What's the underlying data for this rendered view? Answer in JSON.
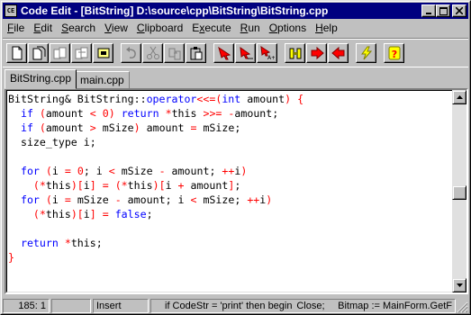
{
  "window": {
    "app_icon_text": "CE",
    "title": "Code Edit - [BitString] D:\\source\\cpp\\BitString\\BitString.cpp",
    "min_glyph": "_",
    "max_glyph": "□",
    "close_glyph": "×"
  },
  "menu": [
    {
      "pre": "",
      "u": "F",
      "post": "ile"
    },
    {
      "pre": "",
      "u": "E",
      "post": "dit"
    },
    {
      "pre": "",
      "u": "S",
      "post": "earch"
    },
    {
      "pre": "",
      "u": "V",
      "post": "iew"
    },
    {
      "pre": "",
      "u": "C",
      "post": "lipboard"
    },
    {
      "pre": "E",
      "u": "x",
      "post": "ecute"
    },
    {
      "pre": "",
      "u": "R",
      "post": "un"
    },
    {
      "pre": "",
      "u": "O",
      "post": "ptions"
    },
    {
      "pre": "",
      "u": "H",
      "post": "elp"
    }
  ],
  "toolbar": {
    "groups": [
      [
        "new-file-icon",
        "open-file-icon",
        "copy-file-icon",
        "save-file-icon",
        "save-all-icon"
      ],
      [
        "undo-icon",
        "cut-icon",
        "copy-icon",
        "paste-icon"
      ],
      [
        "find-icon",
        "find-next-icon",
        "replace-icon"
      ],
      [
        "compile-icon",
        "run-icon",
        "stop-icon"
      ],
      [
        "lightning-icon"
      ],
      [
        "help-icon"
      ]
    ]
  },
  "tabs": [
    {
      "label": "BitString.cpp",
      "active": true
    },
    {
      "label": "main.cpp",
      "active": false
    }
  ],
  "code_lines": [
    [
      [
        "t",
        "BitString& BitString::"
      ],
      [
        "kw",
        "operator"
      ],
      [
        "op",
        "<<=("
      ],
      [
        "kw",
        "int"
      ],
      [
        "t",
        " amount"
      ],
      [
        "op",
        ")"
      ],
      [
        "t",
        " "
      ],
      [
        "op",
        "{"
      ]
    ],
    [
      [
        "t",
        "  "
      ],
      [
        "kw",
        "if"
      ],
      [
        "t",
        " "
      ],
      [
        "op",
        "("
      ],
      [
        "t",
        "amount "
      ],
      [
        "op",
        "<"
      ],
      [
        "t",
        " "
      ],
      [
        "num",
        "0"
      ],
      [
        "op",
        ")"
      ],
      [
        "t",
        " "
      ],
      [
        "kw",
        "return"
      ],
      [
        "t",
        " "
      ],
      [
        "op",
        "*"
      ],
      [
        "t",
        "this "
      ],
      [
        "op",
        ">>="
      ],
      [
        "t",
        " "
      ],
      [
        "op",
        "-"
      ],
      [
        "t",
        "amount;"
      ]
    ],
    [
      [
        "t",
        "  "
      ],
      [
        "kw",
        "if"
      ],
      [
        "t",
        " "
      ],
      [
        "op",
        "("
      ],
      [
        "t",
        "amount "
      ],
      [
        "op",
        ">"
      ],
      [
        "t",
        " mSize"
      ],
      [
        "op",
        ")"
      ],
      [
        "t",
        " amount "
      ],
      [
        "op",
        "="
      ],
      [
        "t",
        " mSize;"
      ]
    ],
    [
      [
        "t",
        "  size_type i;"
      ]
    ],
    [
      [
        "t",
        ""
      ]
    ],
    [
      [
        "t",
        "  "
      ],
      [
        "kw",
        "for"
      ],
      [
        "t",
        " "
      ],
      [
        "op",
        "("
      ],
      [
        "t",
        "i "
      ],
      [
        "op",
        "="
      ],
      [
        "t",
        " "
      ],
      [
        "num",
        "0"
      ],
      [
        "t",
        "; i "
      ],
      [
        "op",
        "<"
      ],
      [
        "t",
        " mSize "
      ],
      [
        "op",
        "-"
      ],
      [
        "t",
        " amount; "
      ],
      [
        "op",
        "++"
      ],
      [
        "t",
        "i"
      ],
      [
        "op",
        ")"
      ]
    ],
    [
      [
        "t",
        "    "
      ],
      [
        "op",
        "(*"
      ],
      [
        "t",
        "this"
      ],
      [
        "op",
        ")["
      ],
      [
        "t",
        "i"
      ],
      [
        "op",
        "]"
      ],
      [
        "t",
        " "
      ],
      [
        "op",
        "="
      ],
      [
        "t",
        " "
      ],
      [
        "op",
        "(*"
      ],
      [
        "t",
        "this"
      ],
      [
        "op",
        ")["
      ],
      [
        "t",
        "i "
      ],
      [
        "op",
        "+"
      ],
      [
        "t",
        " amount"
      ],
      [
        "op",
        "]"
      ],
      [
        "t",
        ";"
      ]
    ],
    [
      [
        "t",
        "  "
      ],
      [
        "kw",
        "for"
      ],
      [
        "t",
        " "
      ],
      [
        "op",
        "("
      ],
      [
        "t",
        "i "
      ],
      [
        "op",
        "="
      ],
      [
        "t",
        " mSize "
      ],
      [
        "op",
        "-"
      ],
      [
        "t",
        " amount; i "
      ],
      [
        "op",
        "<"
      ],
      [
        "t",
        " mSize; "
      ],
      [
        "op",
        "++"
      ],
      [
        "t",
        "i"
      ],
      [
        "op",
        ")"
      ]
    ],
    [
      [
        "t",
        "    "
      ],
      [
        "op",
        "(*"
      ],
      [
        "t",
        "this"
      ],
      [
        "op",
        ")["
      ],
      [
        "t",
        "i"
      ],
      [
        "op",
        "]"
      ],
      [
        "t",
        " "
      ],
      [
        "op",
        "="
      ],
      [
        "t",
        " "
      ],
      [
        "kw",
        "false"
      ],
      [
        "t",
        ";"
      ]
    ],
    [
      [
        "t",
        ""
      ]
    ],
    [
      [
        "t",
        "  "
      ],
      [
        "kw",
        "return"
      ],
      [
        "t",
        " "
      ],
      [
        "op",
        "*"
      ],
      [
        "t",
        "this;"
      ]
    ],
    [
      [
        "op",
        "}"
      ]
    ]
  ],
  "status": {
    "position": "185: 1",
    "modified": "",
    "mode": "Insert",
    "message": "if CodeStr = 'print' then begin",
    "message2": "Close;",
    "message3": "Bitmap := MainForm.GetF"
  },
  "colors": {
    "keyword": "#0000ff",
    "operator": "#ff0000",
    "titlebar": "#000080"
  }
}
